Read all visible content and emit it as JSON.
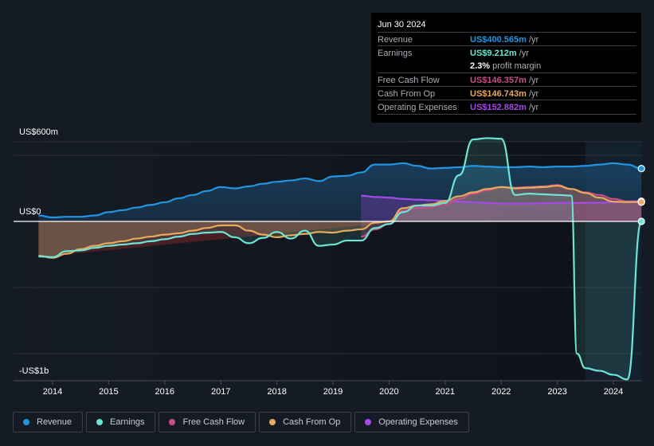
{
  "tooltip": {
    "date": "Jun 30 2024",
    "rows": [
      {
        "label": "Revenue",
        "value": "US$400.565m",
        "unit": "/yr",
        "color": "#2394df"
      },
      {
        "label": "Earnings",
        "value": "US$9.212m",
        "unit": "/yr",
        "color": "#6ce5d3"
      },
      {
        "label": "",
        "value": "2.3%",
        "unit": "profit margin",
        "color": "#ffffff"
      },
      {
        "label": "Free Cash Flow",
        "value": "US$146.357m",
        "unit": "/yr",
        "color": "#c94f8a"
      },
      {
        "label": "Cash From Op",
        "value": "US$146.743m",
        "unit": "/yr",
        "color": "#e8aa5c"
      },
      {
        "label": "Operating Expenses",
        "value": "US$152.882m",
        "unit": "/yr",
        "color": "#a549e8"
      }
    ]
  },
  "legend": [
    {
      "label": "Revenue",
      "color": "#2394df"
    },
    {
      "label": "Earnings",
      "color": "#6ce5d3"
    },
    {
      "label": "Free Cash Flow",
      "color": "#c94f8a"
    },
    {
      "label": "Cash From Op",
      "color": "#e8aa5c"
    },
    {
      "label": "Operating Expenses",
      "color": "#a549e8"
    }
  ],
  "chart_data": {
    "type": "line",
    "title": "",
    "xlabel": "",
    "ylabel": "",
    "ylim": [
      -1200,
      600
    ],
    "y_tick_labels": [
      {
        "value": 600,
        "label": "US$600m"
      },
      {
        "value": 0,
        "label": "US$0"
      },
      {
        "value": -1000,
        "label": "-US$1b"
      }
    ],
    "x_ticks": [
      2014,
      2015,
      2016,
      2017,
      2018,
      2019,
      2020,
      2021,
      2022,
      2023,
      2024
    ],
    "xlim": [
      2013.3,
      2024.5
    ],
    "forecast_start": 2023.5,
    "series": [
      {
        "name": "Revenue",
        "color": "#2394df",
        "x": [
          2013.75,
          2014.0,
          2014.25,
          2014.5,
          2014.75,
          2015.0,
          2015.25,
          2015.5,
          2015.75,
          2016.0,
          2016.25,
          2016.5,
          2016.75,
          2017.0,
          2017.25,
          2017.5,
          2017.75,
          2018.0,
          2018.25,
          2018.5,
          2018.75,
          2019.0,
          2019.25,
          2019.5,
          2019.75,
          2020.0,
          2020.25,
          2020.5,
          2020.75,
          2021.0,
          2021.25,
          2021.5,
          2021.75,
          2022.0,
          2022.25,
          2022.5,
          2022.75,
          2023.0,
          2023.25,
          2023.5,
          2023.75,
          2024.0,
          2024.25,
          2024.5
        ],
        "values": [
          45,
          30,
          35,
          35,
          45,
          70,
          85,
          105,
          125,
          145,
          175,
          200,
          230,
          260,
          250,
          265,
          285,
          300,
          310,
          325,
          305,
          340,
          345,
          370,
          430,
          430,
          440,
          420,
          400,
          405,
          410,
          420,
          415,
          410,
          410,
          415,
          410,
          415,
          415,
          420,
          430,
          440,
          430,
          400
        ]
      },
      {
        "name": "Earnings",
        "color": "#6ce5d3",
        "x": [
          2013.75,
          2014.0,
          2014.25,
          2014.5,
          2014.75,
          2015.0,
          2015.25,
          2015.5,
          2015.75,
          2016.0,
          2016.25,
          2016.5,
          2016.75,
          2017.0,
          2017.25,
          2017.5,
          2017.75,
          2018.0,
          2018.25,
          2018.5,
          2018.75,
          2019.0,
          2019.25,
          2019.5,
          2019.75,
          2020.0,
          2020.25,
          2020.5,
          2020.75,
          2021.0,
          2021.25,
          2021.5,
          2021.75,
          2022.0,
          2022.25,
          2022.5,
          2022.75,
          2023.0,
          2023.25,
          2023.35,
          2023.5,
          2023.75,
          2024.0,
          2024.25,
          2024.5
        ],
        "values": [
          -265,
          -270,
          -225,
          -220,
          -200,
          -185,
          -175,
          -165,
          -150,
          -135,
          -115,
          -95,
          -85,
          -80,
          -120,
          -165,
          -125,
          -80,
          -130,
          -70,
          -185,
          -175,
          -145,
          -145,
          -50,
          -20,
          70,
          120,
          120,
          140,
          350,
          620,
          630,
          625,
          200,
          210,
          205,
          200,
          195,
          -1000,
          -1110,
          -1130,
          -1160,
          -1195,
          0
        ]
      },
      {
        "name": "Free Cash Flow",
        "color": "#c94f8a",
        "x": [
          2019.5,
          2019.75,
          2020.0,
          2020.25,
          2020.5,
          2020.75,
          2021.0,
          2021.25,
          2021.5,
          2021.75,
          2022.0,
          2022.25,
          2022.5,
          2022.75,
          2023.0,
          2023.25,
          2023.5,
          2023.75,
          2024.0,
          2024.25,
          2024.5
        ],
        "values": [
          -115,
          -60,
          -20,
          80,
          100,
          110,
          130,
          170,
          210,
          235,
          260,
          255,
          260,
          265,
          275,
          245,
          220,
          200,
          170,
          150,
          146
        ]
      },
      {
        "name": "Cash From Op",
        "color": "#e8aa5c",
        "x": [
          2013.75,
          2014.0,
          2014.25,
          2014.5,
          2014.75,
          2015.0,
          2015.25,
          2015.5,
          2015.75,
          2016.0,
          2016.25,
          2016.5,
          2016.75,
          2017.0,
          2017.25,
          2017.5,
          2017.75,
          2018.0,
          2018.25,
          2018.5,
          2018.75,
          2019.0,
          2019.25,
          2019.5,
          2019.75,
          2020.0,
          2020.25,
          2020.5,
          2020.75,
          2021.0,
          2021.25,
          2021.5,
          2021.75,
          2022.0,
          2022.25,
          2022.5,
          2022.75,
          2023.0,
          2023.25,
          2023.5,
          2023.75,
          2024.0,
          2024.25,
          2024.5
        ],
        "values": [
          -260,
          -275,
          -245,
          -210,
          -185,
          -165,
          -150,
          -130,
          -115,
          -100,
          -90,
          -70,
          -50,
          -30,
          -30,
          -70,
          -100,
          -120,
          -105,
          -95,
          -80,
          -85,
          -70,
          -60,
          -10,
          0,
          100,
          120,
          130,
          155,
          190,
          220,
          245,
          260,
          250,
          255,
          260,
          270,
          245,
          215,
          180,
          150,
          146,
          147
        ]
      },
      {
        "name": "Operating Expenses",
        "color": "#a549e8",
        "x": [
          2019.5,
          2019.75,
          2020.0,
          2020.25,
          2020.5,
          2020.75,
          2021.0,
          2021.25,
          2021.5,
          2021.75,
          2022.0,
          2022.25,
          2022.5,
          2022.75,
          2023.0,
          2023.25,
          2023.5,
          2023.75,
          2024.0,
          2024.25,
          2024.5
        ],
        "values": [
          195,
          185,
          180,
          170,
          165,
          160,
          155,
          150,
          145,
          140,
          135,
          135,
          135,
          138,
          140,
          140,
          140,
          142,
          145,
          152,
          153
        ]
      }
    ]
  }
}
